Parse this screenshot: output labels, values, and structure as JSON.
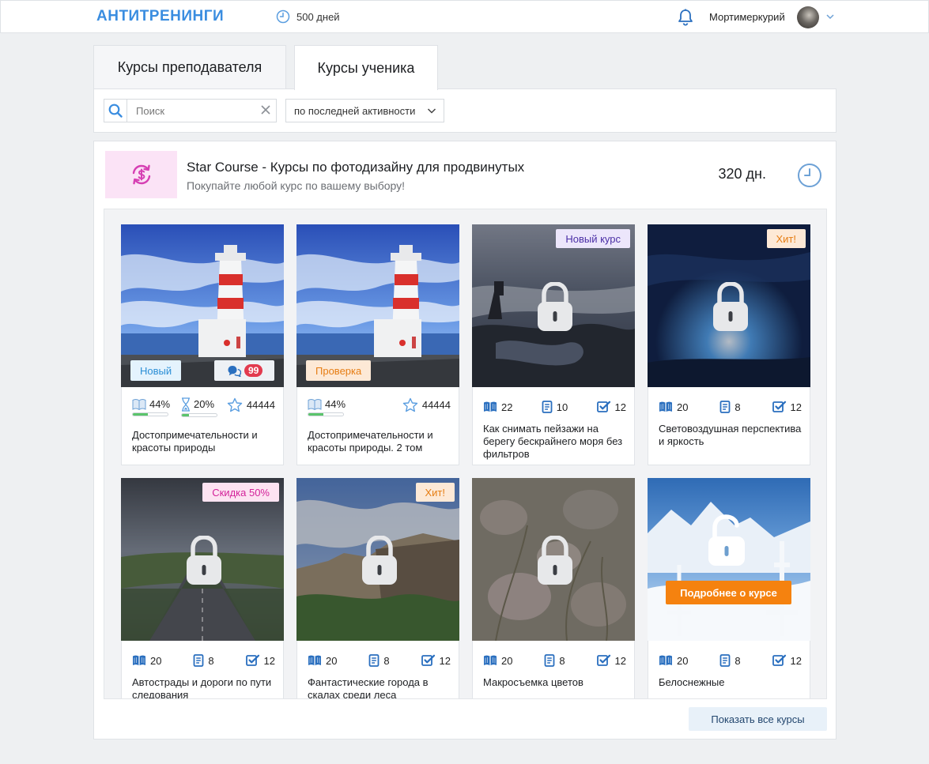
{
  "header": {
    "logo": "АНТИТРЕНИНГИ",
    "days": "500 дней",
    "username": "Мортимеркурий"
  },
  "tabs": [
    {
      "label": "Курсы преподавателя",
      "active": false
    },
    {
      "label": "Курсы ученика",
      "active": true
    }
  ],
  "filters": {
    "search_placeholder": "Поиск",
    "search_value": "",
    "sort_label": "по последней активности"
  },
  "course": {
    "title": "Star Course - Курсы по фотодизайну для продвинутых",
    "subtitle": "Покупайте любой курс по вашему выбору!",
    "days_left": "320 дн.",
    "accent_color": "#d63fb3"
  },
  "cards": [
    {
      "title": "Достопримечательности и красоты природы",
      "chip": "Новый",
      "messages": "99",
      "progress_lessons": "44%",
      "progress_lessons_fraction": 0.44,
      "progress_tasks": "20%",
      "progress_tasks_fraction": 0.2,
      "rating": "44444"
    },
    {
      "title": "Достопримечательности и красоты природы. 2 том",
      "chip": "Проверка",
      "progress_lessons": "44%",
      "progress_lessons_fraction": 0.44,
      "rating": "44444"
    },
    {
      "title": "Как снимать пейзажи на берегу бескрайнего моря без фильтров",
      "badge": "Новый курс",
      "lessons": "22",
      "docs": "10",
      "tasks": "12"
    },
    {
      "title": "Световоздушная перспектива и яркость",
      "badge": "Хит!",
      "lessons": "20",
      "docs": "8",
      "tasks": "12"
    },
    {
      "title": "Автострады и дороги по пути следования",
      "badge": "Скидка 50%",
      "lessons": "20",
      "docs": "8",
      "tasks": "12"
    },
    {
      "title": "Фантастические города в скалах среди леса",
      "badge": "Хит!",
      "lessons": "20",
      "docs": "8",
      "tasks": "12"
    },
    {
      "title": "Макросъемка цветов",
      "lessons": "20",
      "docs": "8",
      "tasks": "12"
    },
    {
      "title": "Белоснежные",
      "cta": "Подробнее о курсе",
      "lessons": "20",
      "docs": "8",
      "tasks": "12"
    }
  ],
  "footer": {
    "show_all": "Показать все курсы"
  }
}
